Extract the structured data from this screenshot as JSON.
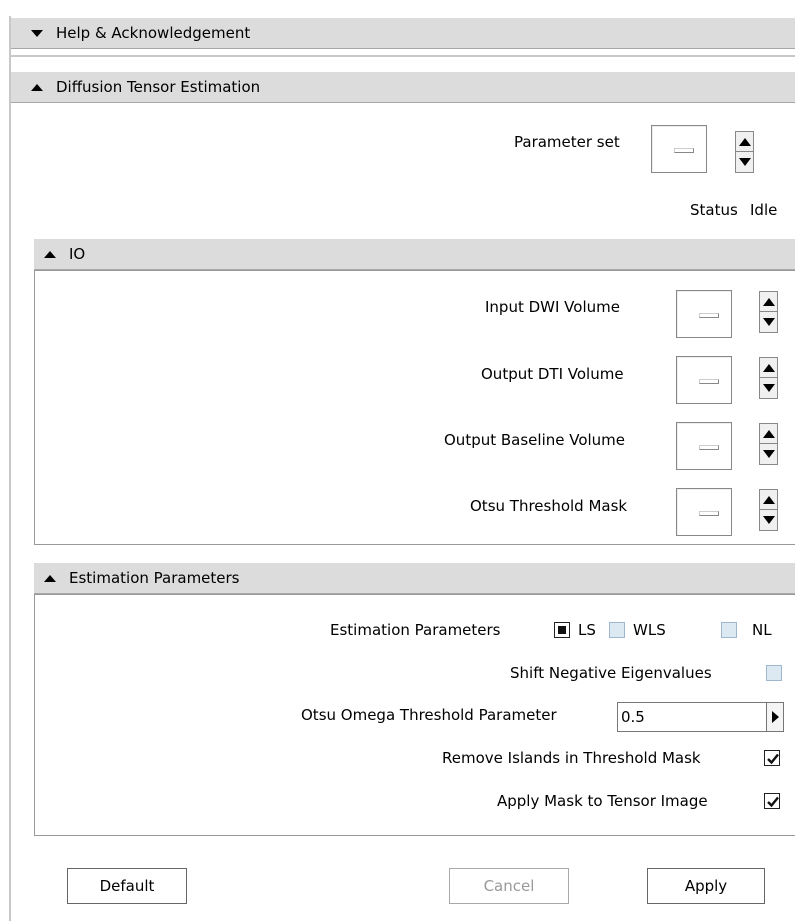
{
  "sections": {
    "help": {
      "title": "Help & Acknowledgement"
    },
    "dti": {
      "title": "Diffusion Tensor Estimation"
    },
    "io": {
      "title": "IO"
    },
    "estimation": {
      "title": "Estimation Parameters"
    }
  },
  "dti": {
    "parameter_set_label": "Parameter set",
    "status_label": "Status",
    "status_value": "Idle"
  },
  "io": {
    "input_dwi_label": "Input DWI Volume",
    "output_dti_label": "Output DTI Volume",
    "output_baseline_label": "Output Baseline Volume",
    "otsu_mask_label": "Otsu Threshold Mask"
  },
  "estimation": {
    "method_label": "Estimation Parameters",
    "options": [
      {
        "label": "LS",
        "selected": true
      },
      {
        "label": "WLS",
        "selected": false
      },
      {
        "label": "NL",
        "selected": false
      }
    ],
    "shift_negative_label": "Shift Negative Eigenvalues",
    "shift_negative_checked": false,
    "otsu_omega_label": "Otsu Omega Threshold Parameter",
    "otsu_omega_value": "0.5",
    "remove_islands_label": "Remove Islands in Threshold Mask",
    "remove_islands_checked": true,
    "apply_mask_label": "Apply Mask to Tensor Image",
    "apply_mask_checked": true
  },
  "buttons": {
    "default": "Default",
    "cancel": "Cancel",
    "apply": "Apply"
  },
  "icons": {
    "collapse": "triangle-down-icon",
    "expand": "triangle-up-icon",
    "spin_up": "spin-up-icon",
    "spin_down": "spin-down-icon",
    "right_arrow": "right-arrow-icon"
  },
  "colors": {
    "header_bg": "#dcdcdc",
    "checkbox_unchecked": "#dce8f2"
  }
}
